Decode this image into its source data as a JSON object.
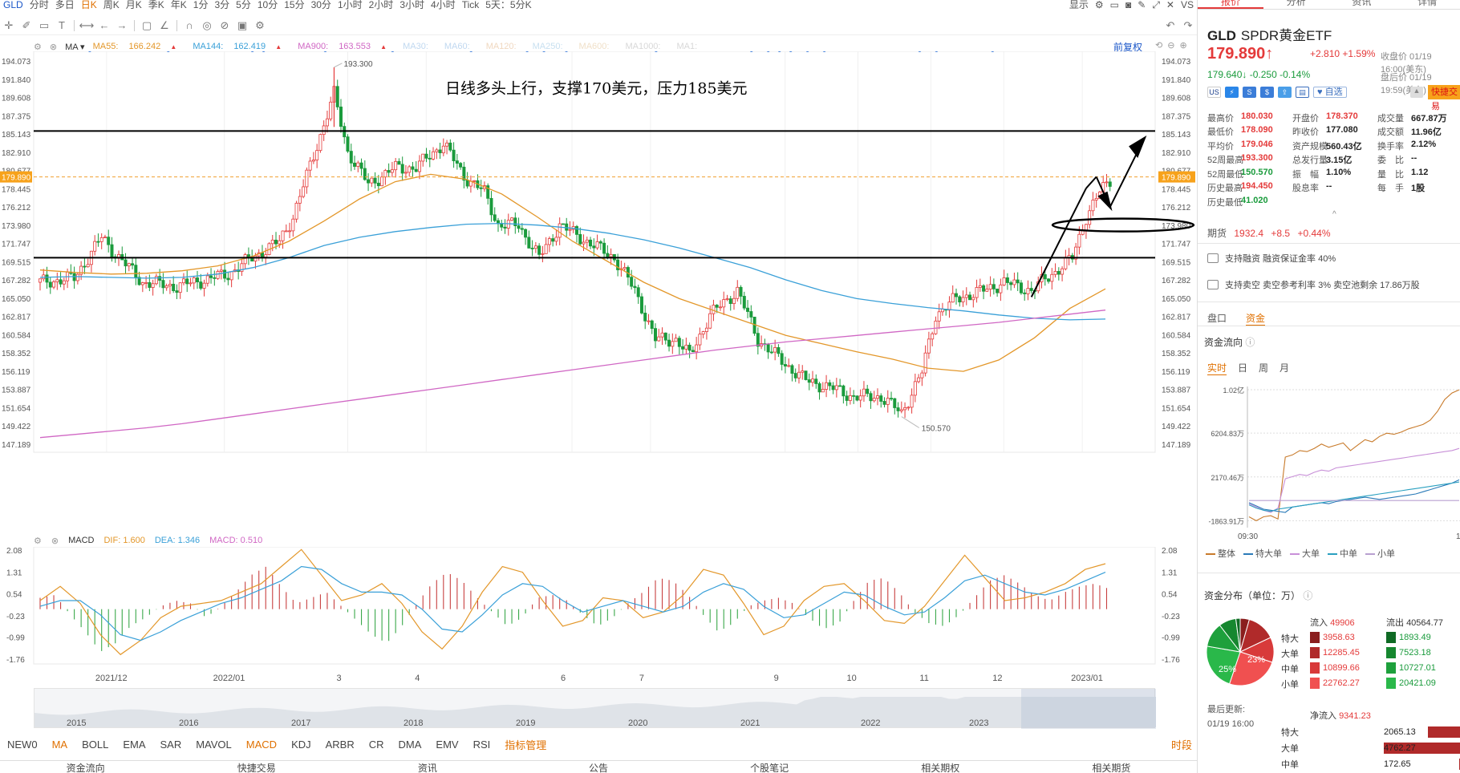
{
  "toolbar": {
    "symbol": "GLD",
    "periods": [
      "分时",
      "多日",
      "日K",
      "周K",
      "月K",
      "季K",
      "年K",
      "1分",
      "3分",
      "5分",
      "10分",
      "15分",
      "30分",
      "1小时",
      "2小时",
      "3小时",
      "4小时",
      "Tick",
      "5天：5分K"
    ],
    "active_period": "日K",
    "right": [
      "显示",
      "VS"
    ],
    "right_icons": [
      "gear-icon",
      "layout-icon",
      "camera-icon",
      "pen-icon",
      "expand-icon",
      "close-icon"
    ]
  },
  "tools": [
    "crosshair-icon",
    "pencil-icon",
    "rect-icon",
    "text-icon",
    "measure-icon",
    "arrow-left-icon",
    "arrow-right-icon",
    "comment-icon",
    "ruler-icon",
    "magnet-icon",
    "eye-icon",
    "lock-icon",
    "trash-icon",
    "gear-icon"
  ],
  "ma_legend": {
    "name": "MA",
    "items": [
      {
        "label": "MA55:",
        "value": "166.242",
        "color": "#e3972a"
      },
      {
        "label": "MA144:",
        "value": "162.419",
        "color": "#3aa0d8"
      },
      {
        "label": "MA900:",
        "value": "163.553",
        "color": "#d067c4"
      },
      {
        "label": "MA30:",
        "value": "",
        "color": "#c0d8f0"
      },
      {
        "label": "MA60:",
        "value": "",
        "color": "#c0d8f0"
      },
      {
        "label": "MA120:",
        "value": "",
        "color": "#f0d8c0"
      },
      {
        "label": "MA250:",
        "value": "",
        "color": "#c8e0f0"
      },
      {
        "label": "MA600:",
        "value": "",
        "color": "#f0e0c8"
      },
      {
        "label": "MA1000:",
        "value": "",
        "color": "#d8d8d8"
      },
      {
        "label": "MA1:",
        "value": "",
        "color": "#d8d8d8"
      }
    ],
    "adjust": "前复权"
  },
  "chart_data": [
    {
      "type": "line",
      "title": "",
      "annotation": "日线多头上行，支撑170美元，压力185美元",
      "yaxis_ticks": [
        "194.073",
        "191.840",
        "189.608",
        "187.375",
        "185.143",
        "182.910",
        "180.677",
        "178.445",
        "176.212",
        "173.980",
        "171.747",
        "169.515",
        "167.282",
        "165.050",
        "162.817",
        "160.584",
        "158.352",
        "156.119",
        "153.887",
        "151.654",
        "149.422",
        "147.189"
      ],
      "ylim": [
        147.189,
        194.073
      ],
      "current_price_label": "179.890",
      "high_label": "193.300",
      "low_label": "150.570",
      "support_level": 170,
      "resistance_level": 185.5,
      "x_labels": [
        "2021/12",
        "2022/01",
        "3",
        "4",
        "6",
        "7",
        "9",
        "10",
        "11",
        "12",
        "2023/01"
      ],
      "series": [
        {
          "name": "MA55",
          "values": [
            168.5,
            168.2,
            168,
            168.1,
            168.4,
            169,
            170.2,
            172,
            174.5,
            177.2,
            179.3,
            180.2,
            179.6,
            177.8,
            175,
            172,
            169.5,
            167,
            165,
            163.5,
            162,
            160.5,
            159.5,
            158.5,
            157.6,
            156.5,
            156.1,
            157.5,
            160.2,
            163.8,
            166.2
          ]
        },
        {
          "name": "MA144",
          "values": [
            167.6,
            167.7,
            167.6,
            167.5,
            167.6,
            168,
            168.8,
            170,
            171.5,
            172.5,
            173.2,
            173.7,
            174.1,
            174.2,
            174,
            173.6,
            173,
            172.2,
            171.2,
            170,
            168.8,
            167.3,
            166,
            165,
            164.4,
            163.9,
            163.5,
            163,
            162.6,
            162.4,
            162.5
          ]
        },
        {
          "name": "MA900",
          "values": [
            148,
            148.4,
            148.8,
            149.2,
            149.7,
            150.3,
            150.9,
            151.5,
            152.1,
            152.7,
            153.3,
            153.9,
            154.5,
            155.1,
            155.7,
            156.3,
            156.9,
            157.5,
            158.1,
            158.7,
            159.2,
            159.7,
            160.1,
            160.5,
            160.9,
            161.3,
            161.7,
            162.1,
            162.6,
            163.1,
            163.6
          ]
        }
      ]
    },
    {
      "type": "bar",
      "title": "",
      "indicator": "MACD",
      "dif_label": "DIF:",
      "dif": "1.600",
      "dea_label": "DEA:",
      "dea": "1.346",
      "macd_label": "MACD:",
      "macd": "0.510",
      "yaxis_ticks": [
        "2.08",
        "1.31",
        "0.54",
        "-0.23",
        "-0.99",
        "-1.76"
      ],
      "ylim": [
        -1.76,
        2.08
      ],
      "values": [
        0.4,
        0.5,
        -0.2,
        -0.8,
        -1.5,
        -1.2,
        -0.6,
        -0.3,
        0.1,
        0.3,
        0.2,
        -0.3,
        0.1,
        0.6,
        1.2,
        1.5,
        0.8,
        0.2,
        0.4,
        0.6,
        0.1,
        -0.4,
        -0.9,
        -1.2,
        -0.6,
        0.2,
        0.9,
        1.3,
        1.0,
        0.4,
        -0.1,
        -0.6,
        -0.3,
        0.4,
        0.5,
        0.3,
        -0.2,
        -0.6,
        -0.3,
        0.2,
        0.6,
        1.1,
        1.0,
        0.5,
        -0.2,
        -0.8,
        -0.5,
        0.1,
        0.3,
        0.4,
        0.2,
        -0.3,
        -0.7,
        -0.5,
        0.3,
        1.0,
        1.1,
        0.6,
        -0.1,
        -0.5,
        -0.6,
        -0.2,
        0.4,
        1.0,
        1.2,
        0.9,
        0.5,
        0.3,
        0.6,
        0.8,
        0.9,
        0.7
      ],
      "dif_values": [
        0.3,
        0.8,
        0.2,
        -0.9,
        -1.6,
        -1.1,
        -0.3,
        0.1,
        0.2,
        0.3,
        0.6,
        0.9,
        1.5,
        2.1,
        1.2,
        0.3,
        0.5,
        0.9,
        0.2,
        -0.8,
        -1.4,
        -0.6,
        0.6,
        1.5,
        1.3,
        0.3,
        -0.6,
        -0.4,
        0.4,
        0.3,
        -0.3,
        -0.1,
        0.5,
        1.4,
        1.2,
        0.2,
        -0.9,
        -0.6,
        0.3,
        0.8,
        0.9,
        0.3,
        -0.4,
        -0.5,
        0.1,
        1.0,
        1.9,
        1.1,
        0.3,
        0.4,
        0.6,
        0.9,
        1.4,
        1.6
      ],
      "dea_values": [
        0.1,
        0.3,
        0.3,
        -0.2,
        -0.9,
        -1.1,
        -0.8,
        -0.4,
        -0.1,
        0.2,
        0.4,
        0.7,
        1.0,
        1.5,
        1.4,
        0.9,
        0.6,
        0.6,
        0.5,
        0.0,
        -0.7,
        -0.8,
        -0.2,
        0.5,
        0.9,
        0.8,
        0.3,
        -0.1,
        0.1,
        0.3,
        0.1,
        -0.1,
        0.1,
        0.6,
        0.9,
        0.7,
        0.1,
        -0.3,
        -0.2,
        0.2,
        0.6,
        0.5,
        0.1,
        -0.2,
        -0.1,
        0.4,
        1.0,
        1.2,
        0.9,
        0.6,
        0.5,
        0.7,
        1.0,
        1.3
      ]
    }
  ],
  "overview_years": [
    "2015",
    "2016",
    "2017",
    "2018",
    "2019",
    "2020",
    "2021",
    "2022",
    "2023"
  ],
  "indicators": [
    "NEW0",
    "MA",
    "BOLL",
    "EMA",
    "SAR",
    "MAVOL",
    "MACD",
    "KDJ",
    "ARBR",
    "CR",
    "DMA",
    "EMV",
    "RSI",
    "指标管理"
  ],
  "indicator_right": "时段",
  "bottom_tabs": [
    "资金流向",
    "快捷交易",
    "资讯",
    "公告",
    "个股笔记",
    "相关期权",
    "相关期货"
  ],
  "right": {
    "tabs": [
      "报价",
      "分析",
      "资讯",
      "详情"
    ],
    "code": "GLD",
    "name": "SPDR黄金ETF",
    "price": "179.890",
    "arrow": "↑",
    "change": "+2.810",
    "change_pct": "+1.59%",
    "close_time": "收盘价 01/19 16:00(美东)",
    "after_price": "179.640",
    "after_arrow": "↓",
    "after_change": "-0.250",
    "after_pct": "-0.14%",
    "after_time": "盘后价 01/19 19:59(美东)",
    "badges": [
      "US",
      "S",
      "$"
    ],
    "badge_text": "自选",
    "fast_trade": "快捷交易",
    "stats": [
      [
        {
          "k": "最高价",
          "v": "180.030",
          "c": "r"
        },
        {
          "k": "开盘价",
          "v": "178.370",
          "c": "r"
        },
        {
          "k": "成交量",
          "v": "667.87万",
          "c": "bk"
        }
      ],
      [
        {
          "k": "最低价",
          "v": "178.090",
          "c": "r"
        },
        {
          "k": "昨收价",
          "v": "177.080",
          "c": "bk"
        },
        {
          "k": "成交额",
          "v": "11.96亿",
          "c": "bk"
        }
      ],
      [
        {
          "k": "平均价",
          "v": "179.046",
          "c": "r"
        },
        {
          "k": "资产规模",
          "v": "560.43亿",
          "c": "bk"
        },
        {
          "k": "换手率",
          "v": "2.12%",
          "c": "bk"
        }
      ],
      [
        {
          "k": "52周最高",
          "v": "193.300",
          "c": "r"
        },
        {
          "k": "总发行量",
          "v": "3.15亿",
          "c": "bk"
        },
        {
          "k": "委　比",
          "v": "--",
          "c": "bk"
        }
      ],
      [
        {
          "k": "52周最低",
          "v": "150.570",
          "c": "g"
        },
        {
          "k": "振　幅",
          "v": "1.10%",
          "c": "bk"
        },
        {
          "k": "量　比",
          "v": "1.12",
          "c": "bk"
        }
      ],
      [
        {
          "k": "历史最高",
          "v": "194.450",
          "c": "r"
        },
        {
          "k": "股息率",
          "v": "--",
          "c": "bk"
        },
        {
          "k": "每　手",
          "v": "1股",
          "c": "bk"
        }
      ],
      [
        {
          "k": "历史最低",
          "v": "41.020",
          "c": "g"
        },
        {
          "k": "",
          "v": "",
          "c": "bk"
        },
        {
          "k": "",
          "v": "",
          "c": "bk"
        }
      ]
    ],
    "future_label": "期货",
    "future_price": "1932.4",
    "future_chg": "+8.5",
    "future_pct": "+0.44%",
    "margin_text": "支持融资 融资保证金率 40%",
    "short_text": "支持卖空 卖空参考利率 3% 卖空池剩余 17.86万股",
    "tabs2": [
      "盘口",
      "资金"
    ],
    "flow_title": "资金流向",
    "flow_tabs": [
      "实时",
      "日",
      "周",
      "月"
    ],
    "flow_y": [
      "1.02亿",
      "6204.83万",
      "2170.46万",
      "-1863.91万"
    ],
    "flow_x": "09:30",
    "flow_x_right": "1",
    "flow_series": [
      {
        "name": "整体",
        "color": "#c87a2a",
        "values": [
          -1500,
          -1863,
          -1500,
          -1400,
          -1700,
          4000,
          4200,
          4600,
          4500,
          4800,
          5200,
          4900,
          5100,
          5300,
          4600,
          5100,
          5600,
          5400,
          5900,
          6200,
          6100,
          6300,
          6600,
          6800,
          7000,
          7400,
          8200,
          9300,
          9900,
          10200
        ]
      },
      {
        "name": "特大单",
        "color": "#2a7ab8",
        "values": [
          -200,
          -500,
          -800,
          -900,
          -1000,
          -1100,
          -600,
          -500,
          -400,
          -300,
          -200,
          -300,
          -100,
          0,
          100,
          200,
          300,
          200,
          100,
          200,
          300,
          400,
          500,
          600,
          800,
          1000,
          1200,
          1400,
          1600,
          1900
        ]
      },
      {
        "name": "大单",
        "color": "#c890d8",
        "values": [
          -300,
          -600,
          -900,
          -1100,
          -700,
          2000,
          2200,
          2400,
          2300,
          2600,
          2800,
          2700,
          3000,
          3100,
          3200,
          3300,
          3400,
          3500,
          3600,
          3700,
          3800,
          3900,
          4000,
          4100,
          4200,
          4300,
          4400,
          4500,
          4600,
          4800
        ]
      },
      {
        "name": "中单",
        "color": "#2aa0c0",
        "values": [
          -400,
          -700,
          -900,
          -1000,
          -800,
          -700,
          -600,
          -500,
          -400,
          -300,
          -200,
          -100,
          0,
          100,
          200,
          300,
          400,
          500,
          600,
          700,
          800,
          900,
          1000,
          1100,
          1200,
          1300,
          1400,
          1500,
          1600,
          1700
        ]
      },
      {
        "name": "小单",
        "color": "#b8a0d0",
        "values": [
          0,
          0,
          0,
          0,
          0,
          0,
          0,
          0,
          0,
          0,
          0,
          0,
          0,
          0,
          0,
          0,
          0,
          0,
          0,
          0,
          0,
          0,
          0,
          0,
          0,
          0,
          0,
          0,
          0,
          0
        ]
      }
    ],
    "flow_legend": [
      "整体",
      "特大单",
      "大单",
      "中单",
      "小单"
    ],
    "dist_title": "资金分布（单位：万）",
    "pie_labels": [
      "25%",
      "23%"
    ],
    "pie_slices": [
      {
        "name": "特大-流入",
        "value": 3958.63,
        "color": "#8a1e1e"
      },
      {
        "name": "大单-流入",
        "value": 12285.45,
        "color": "#b02a2a"
      },
      {
        "name": "中单-流入",
        "value": 10899.66,
        "color": "#d83a3a"
      },
      {
        "name": "小单-流入",
        "value": 22762.27,
        "color": "#f05050"
      },
      {
        "name": "小单-流出",
        "value": 20421.09,
        "color": "#2ab84a"
      },
      {
        "name": "中单-流出",
        "value": 10727.01,
        "color": "#1ea03c"
      },
      {
        "name": "大单-流出",
        "value": 7523.18,
        "color": "#16872f"
      },
      {
        "name": "特大-流出",
        "value": 1893.49,
        "color": "#0f6a24"
      }
    ],
    "in_label": "流入",
    "in_total": "49906",
    "out_label": "流出",
    "out_total": "40564.77",
    "dist_rows": [
      {
        "name": "特大",
        "in": "3958.63",
        "out": "1893.49",
        "inc": "#8a1e1e",
        "outc": "#0f6a24"
      },
      {
        "name": "大单",
        "in": "12285.45",
        "out": "7523.18",
        "inc": "#b02a2a",
        "outc": "#16872f"
      },
      {
        "name": "中单",
        "in": "10899.66",
        "out": "10727.01",
        "inc": "#d83a3a",
        "outc": "#1ea03c"
      },
      {
        "name": "小单",
        "in": "22762.27",
        "out": "20421.09",
        "inc": "#f05050",
        "outc": "#2ab84a"
      }
    ],
    "update_label": "最后更新:",
    "update_time": "01/19 16:00",
    "net_label": "净流入",
    "net_value": "9341.23",
    "net_rows": [
      {
        "name": "特大",
        "value": "2065.13",
        "frac": 0.36
      },
      {
        "name": "大单",
        "value": "4762.27",
        "frac": 0.82
      },
      {
        "name": "中单",
        "value": "172.65",
        "frac": 0.03
      }
    ]
  }
}
